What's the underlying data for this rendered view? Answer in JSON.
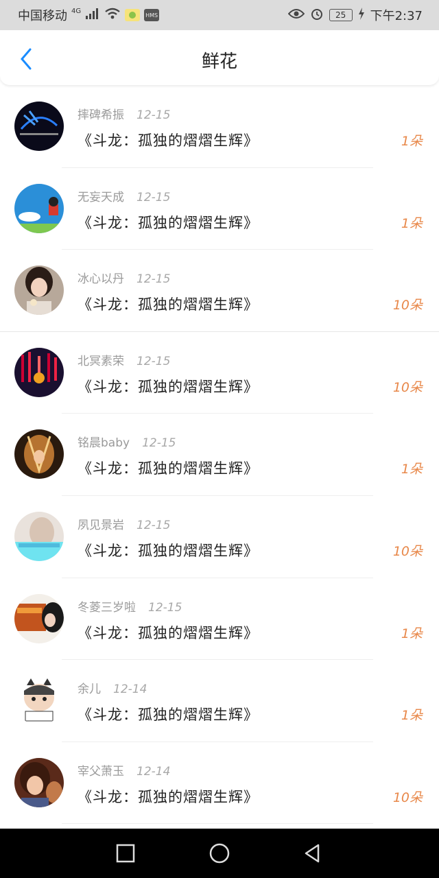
{
  "status_bar": {
    "carrier": "中国移动",
    "network": "4G",
    "battery": "25",
    "time": "下午2:37",
    "hms_badge": "HMS"
  },
  "header": {
    "title": "鲜花",
    "back_icon": "chevron-left-icon"
  },
  "gifts": [
    {
      "name": "摔碑希振",
      "date": "12-15",
      "book": "《斗龙：孤独的熠熠生辉》",
      "count": "1朵"
    },
    {
      "name": "无妄天成",
      "date": "12-15",
      "book": "《斗龙：孤独的熠熠生辉》",
      "count": "1朵"
    },
    {
      "name": "冰心以丹",
      "date": "12-15",
      "book": "《斗龙：孤独的熠熠生辉》",
      "count": "10朵"
    },
    {
      "name": "北冥素荣",
      "date": "12-15",
      "book": "《斗龙：孤独的熠熠生辉》",
      "count": "10朵"
    },
    {
      "name": "铭晨baby",
      "date": "12-15",
      "book": "《斗龙：孤独的熠熠生辉》",
      "count": "1朵"
    },
    {
      "name": "夙见景岩",
      "date": "12-15",
      "book": "《斗龙：孤独的熠熠生辉》",
      "count": "10朵"
    },
    {
      "name": "冬菱三岁啦",
      "date": "12-15",
      "book": "《斗龙：孤独的熠熠生辉》",
      "count": "1朵"
    },
    {
      "name": "余儿",
      "date": "12-14",
      "book": "《斗龙：孤独的熠熠生辉》",
      "count": "1朵"
    },
    {
      "name": "宰父萧玉",
      "date": "12-14",
      "book": "《斗龙：孤独的熠熠生辉》",
      "count": "10朵"
    }
  ],
  "nav_bar": {
    "recent_icon": "square-icon",
    "home_icon": "circle-icon",
    "back_icon": "triangle-back-icon"
  },
  "colors": {
    "accent": "#1a8cff",
    "count": "#e8884a"
  }
}
